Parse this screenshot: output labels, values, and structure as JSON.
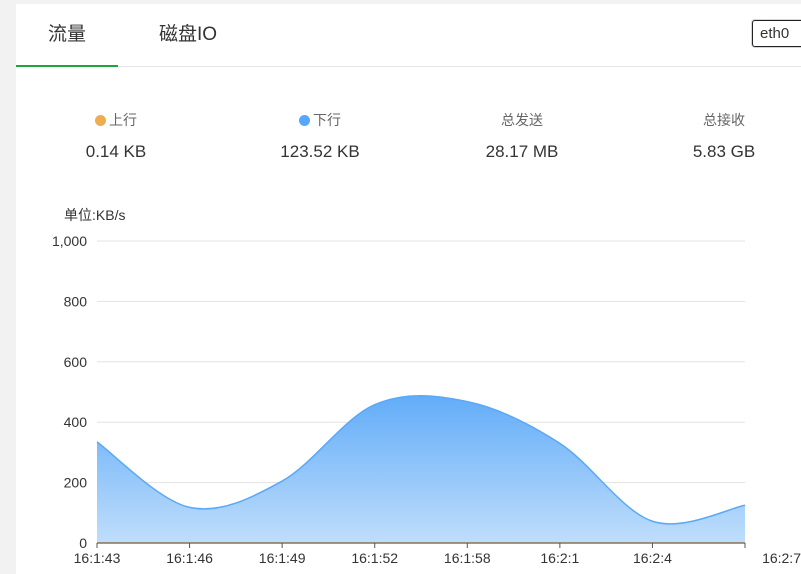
{
  "tabs": [
    {
      "label": "流量",
      "active": true
    },
    {
      "label": "磁盘IO",
      "active": false
    }
  ],
  "interface_select": {
    "value": "eth0"
  },
  "stats": {
    "upload": {
      "label": "上行",
      "value": "0.14 KB",
      "dot_color": "#f0ad4e"
    },
    "download": {
      "label": "下行",
      "value": "123.52 KB",
      "dot_color": "#52a9ff"
    },
    "total_sent": {
      "label": "总发送",
      "value": "28.17 MB"
    },
    "total_received": {
      "label": "总接收",
      "value": "5.83 GB"
    }
  },
  "chart_data": {
    "type": "area",
    "unit_label": "单位:KB/s",
    "x": [
      "16:1:43",
      "16:1:46",
      "16:1:49",
      "16:1:52",
      "16:1:58",
      "16:2:1",
      "16:2:4",
      "16:2:7"
    ],
    "ylim": [
      0,
      1000
    ],
    "yticks": [
      "0",
      "200",
      "400",
      "600",
      "800",
      "1,000"
    ],
    "grid": true,
    "series": [
      {
        "values": [
          335,
          118,
          205,
          458,
          468,
          330,
          72,
          125
        ],
        "color": "#5aa8f8"
      },
      {
        "values": [
          0.14,
          0.14,
          0.14,
          0.14,
          0.14,
          0.14,
          0.14,
          0.14
        ],
        "color": "#f0ad4e"
      }
    ]
  }
}
